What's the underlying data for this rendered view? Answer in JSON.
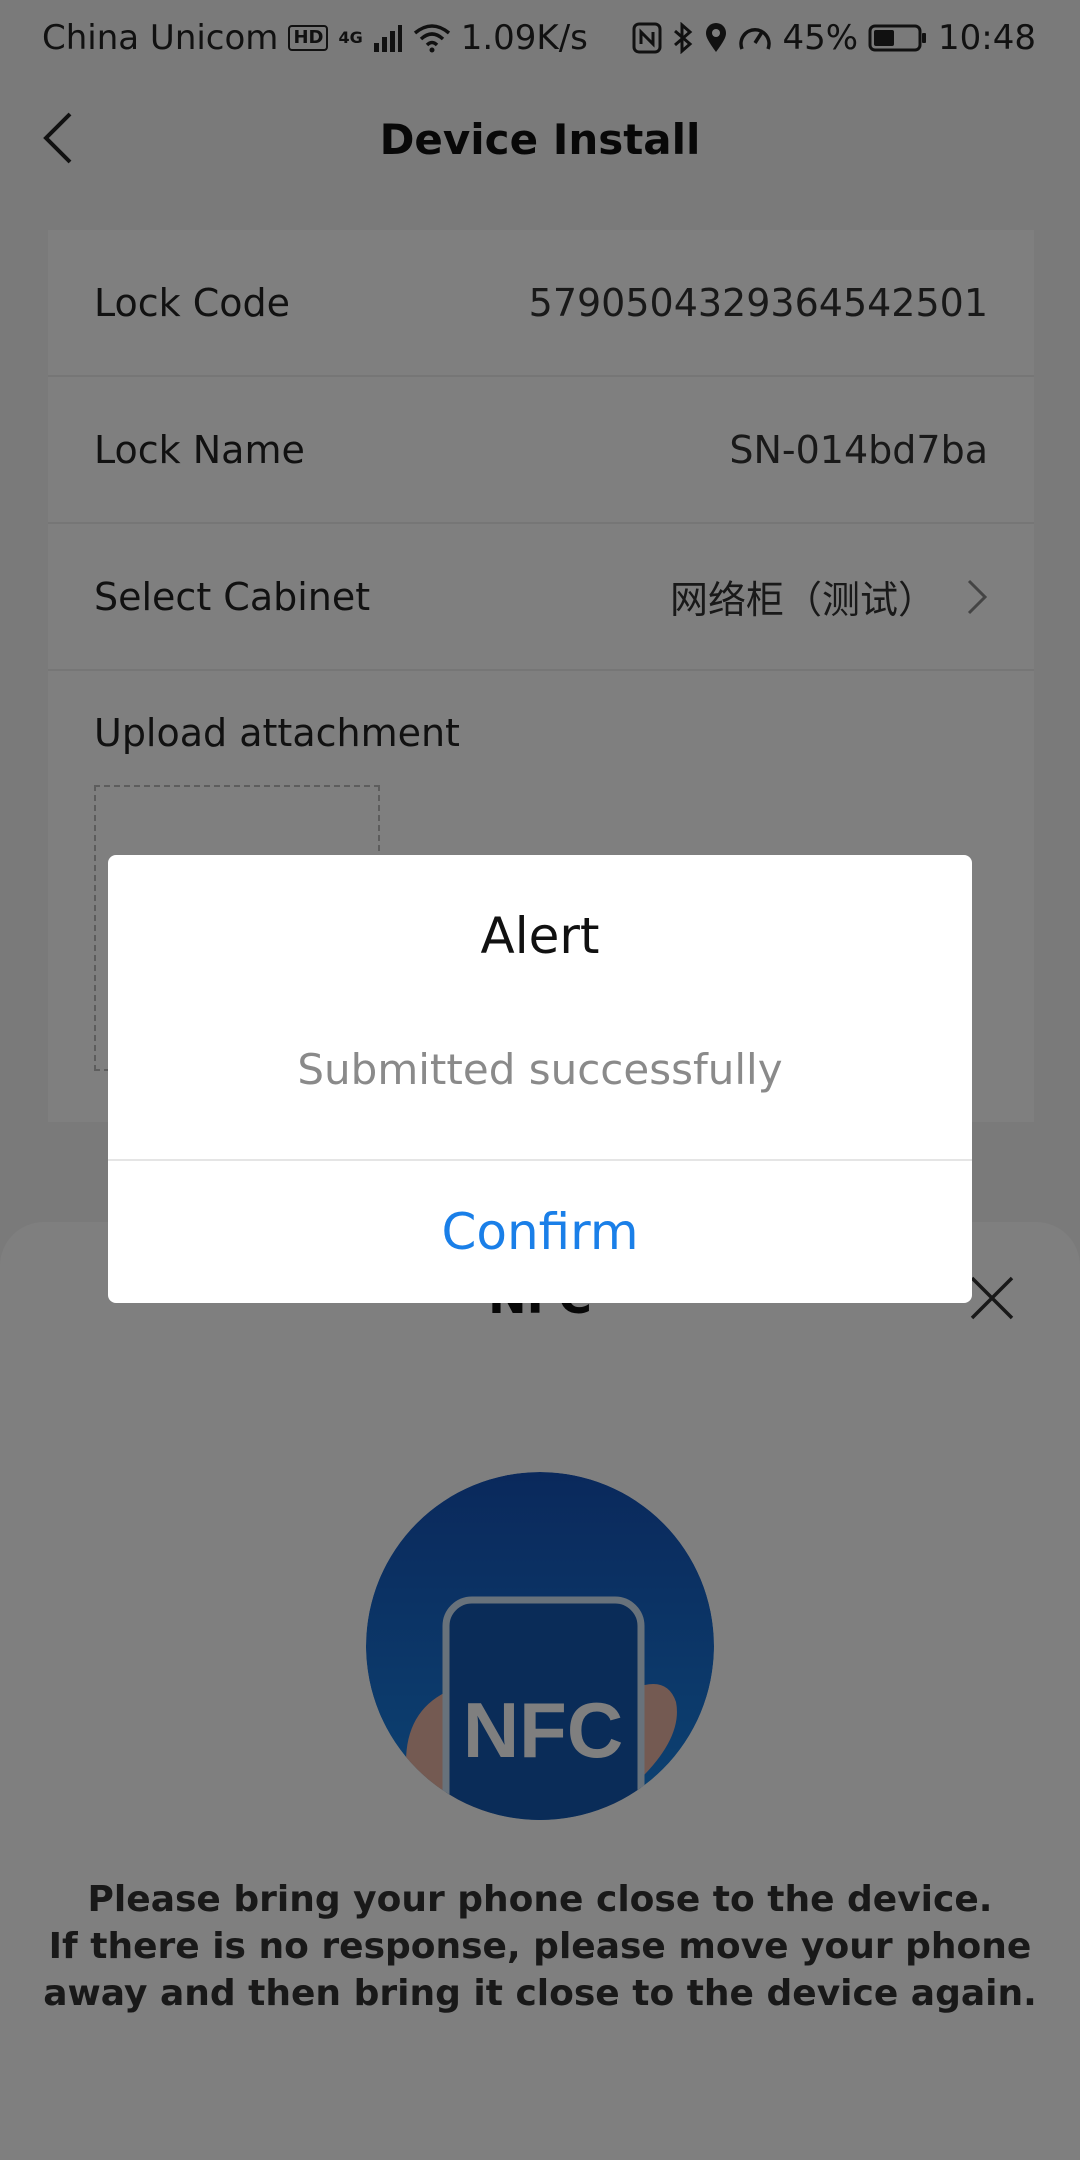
{
  "status_bar": {
    "carrier": "China Unicom",
    "hd_badge": "HD",
    "network_type": "4G",
    "speed": "1.09K/s",
    "battery": "45%",
    "time": "10:48"
  },
  "header": {
    "title": "Device Install"
  },
  "form": {
    "lock_code_label": "Lock Code",
    "lock_code_value": "5790504329364542501",
    "lock_name_label": "Lock Name",
    "lock_name_value": "SN-014bd7ba",
    "cabinet_label": "Select Cabinet",
    "cabinet_value": "网络柜（测试）",
    "upload_label": "Upload attachment"
  },
  "nfc_sheet": {
    "title": "NFC",
    "badge_text": "NFC",
    "instructions_line1": "Please bring your phone close to the device.",
    "instructions_line2": "If there is no response, please move your phone",
    "instructions_line3": "away and then bring it close to the device again.",
    "accent_color": "#1458b0"
  },
  "alert": {
    "title": "Alert",
    "message": "Submitted successfully",
    "confirm_label": "Confirm",
    "confirm_color": "#1a7fe8"
  }
}
